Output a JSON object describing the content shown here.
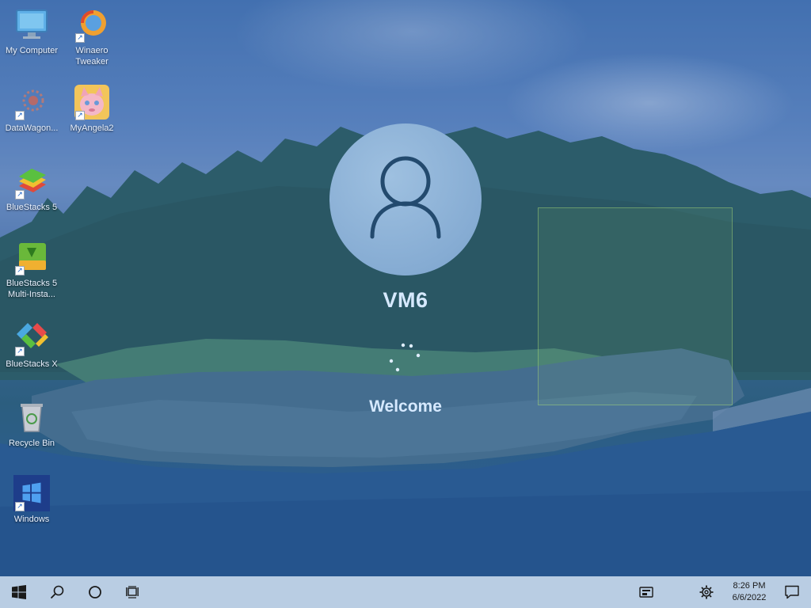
{
  "desktop": {
    "icons": [
      {
        "label": "My Computer",
        "icon": "computer-icon"
      },
      {
        "label": "Winaero Tweaker",
        "icon": "winaero-tweaker-icon"
      },
      {
        "label": "DataWagon...",
        "icon": "datawagon-icon"
      },
      {
        "label": "MyAngela2",
        "icon": "my-angela-icon"
      },
      {
        "label": "BlueStacks 5",
        "icon": "bluestacks-icon"
      },
      {
        "label": "BlueStacks 5 Multi-Insta...",
        "icon": "bluestacks-multi-instance-icon"
      },
      {
        "label": "BlueStacks X",
        "icon": "bluestacks-x-icon"
      },
      {
        "label": "Recycle Bin",
        "icon": "recycle-bin-icon"
      },
      {
        "label": "Windows",
        "icon": "windows-icon"
      }
    ]
  },
  "login": {
    "username": "VM6",
    "status": "Welcome",
    "avatar_icon": "user-icon"
  },
  "taskbar": {
    "start_icon": "windows-logo-icon",
    "search_icon": "search-icon",
    "cortana_icon": "cortana-circle-icon",
    "taskview_icon": "task-view-icon",
    "clock": {
      "time": "8:26 PM",
      "date": "6/6/2022"
    }
  },
  "colors": {
    "taskbar": "#b9cde3",
    "login_text": "#d6e9ff",
    "avatar": "#86acd3"
  }
}
